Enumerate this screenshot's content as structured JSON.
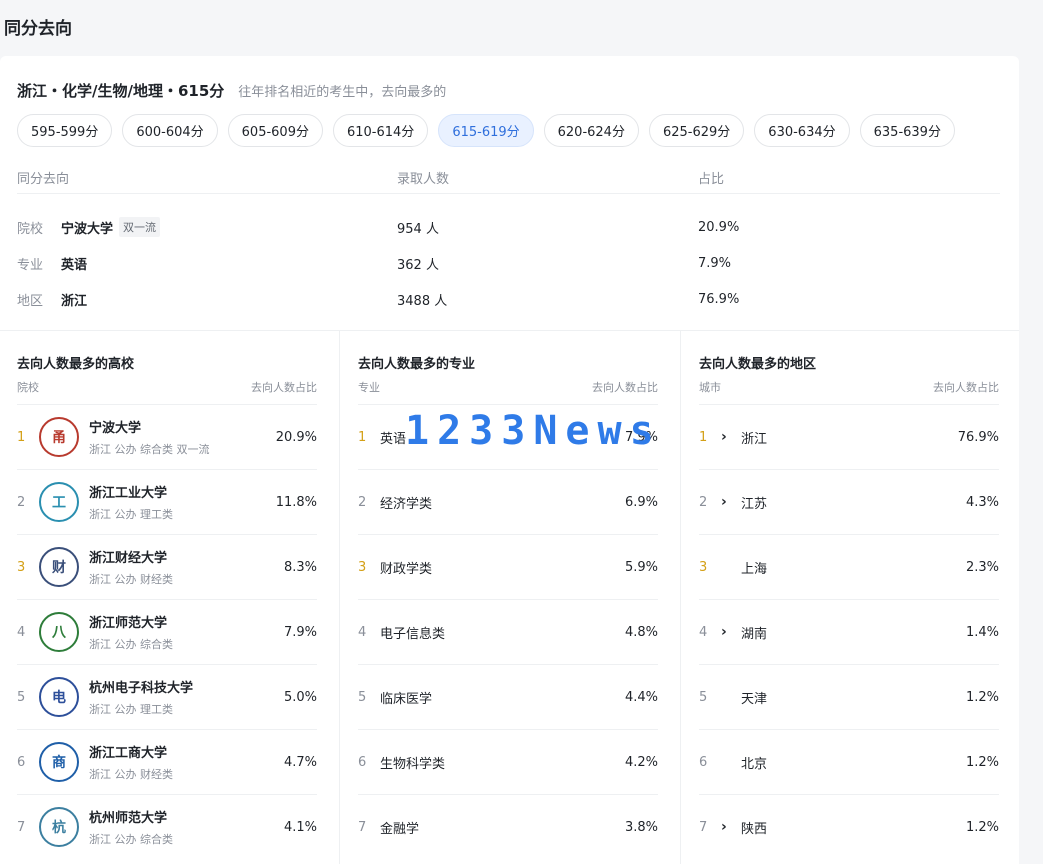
{
  "page_title": "同分去向",
  "heading": {
    "main": "浙江・化学/生物/地理・615分",
    "sub": "往年排名相近的考生中，去向最多的"
  },
  "score_chips": [
    {
      "label": "595-599分",
      "active": false
    },
    {
      "label": "600-604分",
      "active": false
    },
    {
      "label": "605-609分",
      "active": false
    },
    {
      "label": "610-614分",
      "active": false
    },
    {
      "label": "615-619分",
      "active": true
    },
    {
      "label": "620-624分",
      "active": false
    },
    {
      "label": "625-629分",
      "active": false
    },
    {
      "label": "630-634分",
      "active": false
    },
    {
      "label": "635-639分",
      "active": false
    }
  ],
  "summary": {
    "headers": [
      "同分去向",
      "录取人数",
      "占比"
    ],
    "rows": [
      {
        "label": "院校",
        "name": "宁波大学",
        "tag": "双一流",
        "count": "954 人",
        "ratio": "20.9%"
      },
      {
        "label": "专业",
        "name": "英语",
        "tag": "",
        "count": "362 人",
        "ratio": "7.9%"
      },
      {
        "label": "地区",
        "name": "浙江",
        "tag": "",
        "count": "3488 人",
        "ratio": "76.9%"
      }
    ]
  },
  "top_schools": {
    "title": "去向人数最多的高校",
    "col_left": "院校",
    "col_right": "去向人数占比",
    "items": [
      {
        "rank": "1",
        "name": "宁波大学",
        "meta": "浙江 公办 综合类 双一流",
        "pct": "20.9%",
        "logo_color": "#b83a2e",
        "logo_char": "甬"
      },
      {
        "rank": "2",
        "name": "浙江工业大学",
        "meta": "浙江 公办 理工类",
        "pct": "11.8%",
        "logo_color": "#2a8fb0",
        "logo_char": "工"
      },
      {
        "rank": "3",
        "name": "浙江财经大学",
        "meta": "浙江 公办 财经类",
        "pct": "8.3%",
        "logo_color": "#3a4f7a",
        "logo_char": "财"
      },
      {
        "rank": "4",
        "name": "浙江师范大学",
        "meta": "浙江 公办 综合类",
        "pct": "7.9%",
        "logo_color": "#2e7d3a",
        "logo_char": "八"
      },
      {
        "rank": "5",
        "name": "杭州电子科技大学",
        "meta": "浙江 公办 理工类",
        "pct": "5.0%",
        "logo_color": "#2d4f9a",
        "logo_char": "电"
      },
      {
        "rank": "6",
        "name": "浙江工商大学",
        "meta": "浙江 公办 财经类",
        "pct": "4.7%",
        "logo_color": "#1f5fa8",
        "logo_char": "商"
      },
      {
        "rank": "7",
        "name": "杭州师范大学",
        "meta": "浙江 公办 综合类",
        "pct": "4.1%",
        "logo_color": "#3c7fa0",
        "logo_char": "杭"
      }
    ]
  },
  "top_majors": {
    "title": "去向人数最多的专业",
    "col_left": "专业",
    "col_right": "去向人数占比",
    "items": [
      {
        "rank": "1",
        "name": "英语",
        "pct": "7.9%"
      },
      {
        "rank": "2",
        "name": "经济学类",
        "pct": "6.9%"
      },
      {
        "rank": "3",
        "name": "财政学类",
        "pct": "5.9%"
      },
      {
        "rank": "4",
        "name": "电子信息类",
        "pct": "4.8%"
      },
      {
        "rank": "5",
        "name": "临床医学",
        "pct": "4.4%"
      },
      {
        "rank": "6",
        "name": "生物科学类",
        "pct": "4.2%"
      },
      {
        "rank": "7",
        "name": "金融学",
        "pct": "3.8%"
      }
    ]
  },
  "top_regions": {
    "title": "去向人数最多的地区",
    "col_left": "城市",
    "col_right": "去向人数占比",
    "items": [
      {
        "rank": "1",
        "name": "浙江",
        "pct": "76.9%",
        "expandable": true
      },
      {
        "rank": "2",
        "name": "江苏",
        "pct": "4.3%",
        "expandable": true
      },
      {
        "rank": "3",
        "name": "上海",
        "pct": "2.3%",
        "expandable": false
      },
      {
        "rank": "4",
        "name": "湖南",
        "pct": "1.4%",
        "expandable": true
      },
      {
        "rank": "5",
        "name": "天津",
        "pct": "1.2%",
        "expandable": false
      },
      {
        "rank": "6",
        "name": "北京",
        "pct": "1.2%",
        "expandable": false
      },
      {
        "rank": "7",
        "name": "陕西",
        "pct": "1.2%",
        "expandable": true
      }
    ]
  },
  "watermark": "1233News",
  "colors": {
    "accent": "#2f6fdc",
    "gold_rank": "#d4a017",
    "muted": "#8a8f99"
  }
}
